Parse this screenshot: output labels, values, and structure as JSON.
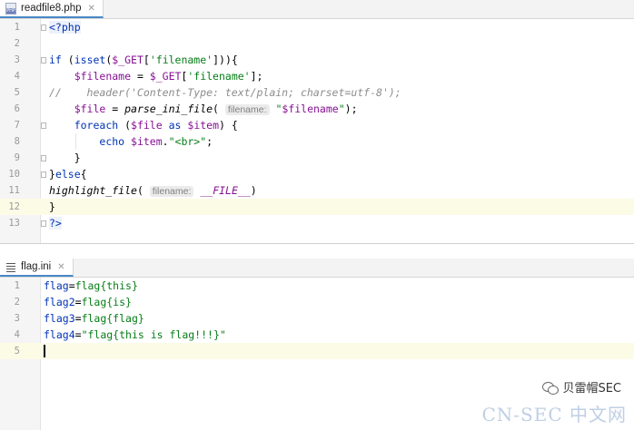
{
  "php_editor": {
    "tab_label": "readfile8.php",
    "close_glyph": "✕",
    "lines": [
      {
        "n": "1",
        "segs": [
          {
            "c": "tag",
            "t": "<?php"
          }
        ]
      },
      {
        "n": "2",
        "segs": []
      },
      {
        "n": "3",
        "segs": [
          {
            "c": "kw",
            "t": "if "
          },
          {
            "c": "",
            "t": "("
          },
          {
            "c": "kw",
            "t": "isset"
          },
          {
            "c": "",
            "t": "("
          },
          {
            "c": "var",
            "t": "$_GET"
          },
          {
            "c": "",
            "t": "["
          },
          {
            "c": "str",
            "t": "'filename'"
          },
          {
            "c": "",
            "t": "])){"
          }
        ]
      },
      {
        "n": "4",
        "segs": [
          {
            "c": "",
            "t": "    "
          },
          {
            "c": "var",
            "t": "$filename"
          },
          {
            "c": "",
            "t": " = "
          },
          {
            "c": "var",
            "t": "$_GET"
          },
          {
            "c": "",
            "t": "["
          },
          {
            "c": "str",
            "t": "'filename'"
          },
          {
            "c": "",
            "t": "];"
          }
        ]
      },
      {
        "n": "5",
        "segs": [
          {
            "c": "cmt",
            "t": "//    header('Content-Type: text/plain; charset=utf-8');"
          }
        ]
      },
      {
        "n": "6",
        "segs": [
          {
            "c": "",
            "t": "    "
          },
          {
            "c": "var",
            "t": "$file"
          },
          {
            "c": "",
            "t": " = "
          },
          {
            "c": "fnc",
            "t": "parse_ini_file"
          },
          {
            "c": "",
            "t": "( "
          },
          {
            "c": "hint",
            "t": "filename:"
          },
          {
            "c": "",
            "t": " "
          },
          {
            "c": "str",
            "t": "\""
          },
          {
            "c": "var",
            "t": "$filename"
          },
          {
            "c": "str",
            "t": "\""
          },
          {
            "c": "",
            "t": ");"
          }
        ]
      },
      {
        "n": "7",
        "segs": [
          {
            "c": "",
            "t": "    "
          },
          {
            "c": "kw",
            "t": "foreach"
          },
          {
            "c": "",
            "t": " ("
          },
          {
            "c": "var",
            "t": "$file"
          },
          {
            "c": "",
            "t": " "
          },
          {
            "c": "kw",
            "t": "as"
          },
          {
            "c": "",
            "t": " "
          },
          {
            "c": "var",
            "t": "$item"
          },
          {
            "c": "",
            "t": ") {"
          }
        ]
      },
      {
        "n": "8",
        "segs": [
          {
            "c": "",
            "t": "        "
          },
          {
            "c": "kw",
            "t": "echo"
          },
          {
            "c": "",
            "t": " "
          },
          {
            "c": "var",
            "t": "$item"
          },
          {
            "c": "",
            "t": "."
          },
          {
            "c": "str",
            "t": "\"<br>\""
          },
          {
            "c": "",
            "t": ";"
          }
        ]
      },
      {
        "n": "9",
        "segs": [
          {
            "c": "",
            "t": "    }"
          }
        ]
      },
      {
        "n": "10",
        "segs": [
          {
            "c": "",
            "t": "}"
          },
          {
            "c": "kw",
            "t": "else"
          },
          {
            "c": "",
            "t": "{"
          }
        ]
      },
      {
        "n": "11",
        "segs": [
          {
            "c": "fnc",
            "t": "highlight_file"
          },
          {
            "c": "",
            "t": "( "
          },
          {
            "c": "hint",
            "t": "filename:"
          },
          {
            "c": "",
            "t": " "
          },
          {
            "c": "const",
            "t": "__FILE__"
          },
          {
            "c": "",
            "t": ")"
          }
        ]
      },
      {
        "n": "12",
        "segs": [
          {
            "c": "",
            "t": "}"
          }
        ]
      },
      {
        "n": "13",
        "segs": [
          {
            "c": "tag",
            "t": "?>"
          }
        ]
      }
    ]
  },
  "ini_editor": {
    "tab_label": "flag.ini",
    "close_glyph": "✕",
    "lines": [
      {
        "n": "1",
        "segs": [
          {
            "c": "ini-key",
            "t": "flag"
          },
          {
            "c": "",
            "t": "="
          },
          {
            "c": "ini-val",
            "t": "flag{this}"
          }
        ]
      },
      {
        "n": "2",
        "segs": [
          {
            "c": "ini-key",
            "t": "flag2"
          },
          {
            "c": "",
            "t": "="
          },
          {
            "c": "ini-val",
            "t": "flag{is}"
          }
        ]
      },
      {
        "n": "3",
        "segs": [
          {
            "c": "ini-key",
            "t": "flag3"
          },
          {
            "c": "",
            "t": "="
          },
          {
            "c": "ini-val",
            "t": "flag{flag}"
          }
        ]
      },
      {
        "n": "4",
        "segs": [
          {
            "c": "ini-key",
            "t": "flag4"
          },
          {
            "c": "",
            "t": "="
          },
          {
            "c": "ini-val",
            "t": "\"flag{this is flag!!!}\""
          }
        ]
      },
      {
        "n": "5",
        "segs": []
      }
    ]
  },
  "watermark": {
    "account": "贝雷帽SEC",
    "site": "CN-SEC 中文网"
  },
  "colors": {
    "keyword": "#0033b3",
    "variable": "#871094",
    "string": "#067d17",
    "comment": "#8c8c8c",
    "caret_line": "#fcfbe6"
  }
}
